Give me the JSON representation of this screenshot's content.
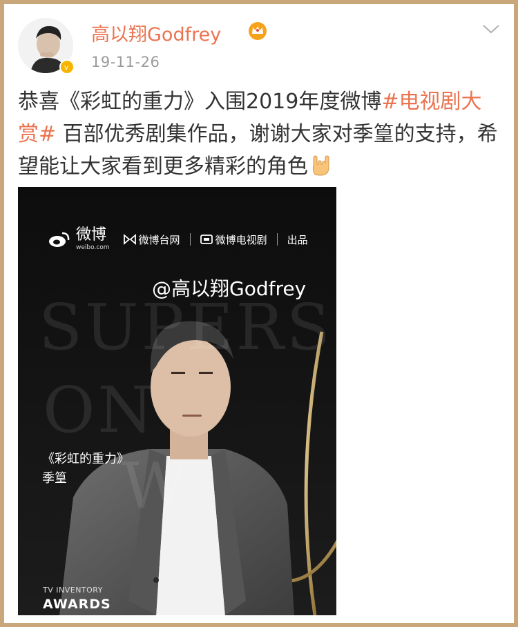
{
  "post": {
    "username": "高以翔Godfrey",
    "timestamp": "19-11-26",
    "text_prefix": "恭喜《彩虹的重力》入围2019年度微博",
    "hashtag": "#电视剧大赏#",
    "text_suffix": " 百部优秀剧集作品，谢谢大家对季篁的支持，希望能让大家看到更多精彩的角色",
    "badges": {
      "verified_icon": "verified-badge-icon",
      "crown_icon": "crown-icon",
      "menu_icon": "chevron-down-icon"
    }
  },
  "image": {
    "weibo_logo_text": "微博",
    "weibo_domain": "weibo.com",
    "brand_1": "微博台网",
    "brand_2": "微博电视剧",
    "brand_3": "出品",
    "mention": "@高以翔Godfrey",
    "show_title": "《彩虹的重力》",
    "role_name": "季篁",
    "awards_small": "TV INVENTORY",
    "awards_big": "AWARDS",
    "background_words": [
      "SUPERS",
      "ON",
      "W"
    ]
  },
  "colors": {
    "frame": "#c9a77a",
    "accent": "#eb7350",
    "text": "#333333",
    "meta": "#9a9a9a"
  }
}
